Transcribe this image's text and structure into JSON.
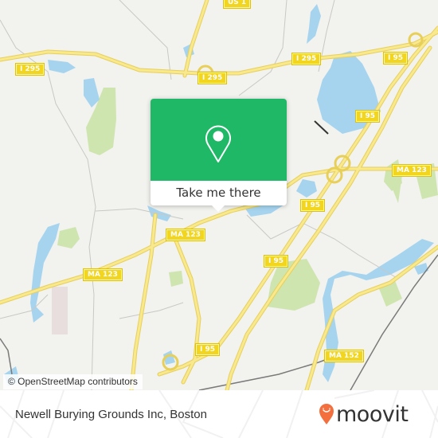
{
  "map": {
    "attribution": "© OpenStreetMap contributors",
    "road_shields": [
      {
        "label": "US 1"
      },
      {
        "label": "I 295"
      },
      {
        "label": "I 295"
      },
      {
        "label": "I 295"
      },
      {
        "label": "I 95"
      },
      {
        "label": "I 95"
      },
      {
        "label": "MA 123"
      },
      {
        "label": "I 95"
      },
      {
        "label": "MA 123"
      },
      {
        "label": "I 95"
      },
      {
        "label": "MA 123"
      },
      {
        "label": "I 95"
      },
      {
        "label": "MA 152"
      }
    ],
    "colors": {
      "land": "#f2f2ee",
      "water": "#a6d4ef",
      "park": "#cfe5b0",
      "highway": "#f6e27a",
      "shield": "#f1d51e"
    }
  },
  "popup": {
    "button_label": "Take me there",
    "icon": "map-pin-icon",
    "color": "#1fb866"
  },
  "footer": {
    "place_name": "Newell Burying Grounds Inc, Boston",
    "brand": "moovit",
    "brand_color": "#f36f3d"
  }
}
